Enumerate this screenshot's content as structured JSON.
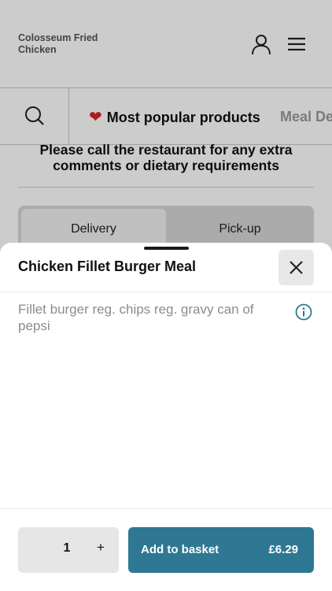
{
  "header": {
    "brand": "Colosseum Fried\nChicken"
  },
  "categories": {
    "active": "Most popular products",
    "next": "Meal De"
  },
  "notice": "Please call the restaurant for any extra comments or dietary requirements",
  "order_mode": {
    "delivery": "Delivery",
    "pickup": "Pick-up",
    "selected": "Delivery"
  },
  "sheet": {
    "title": "Chicken Fillet Burger Meal",
    "description": "Fillet burger reg. chips reg. gravy can of pepsi"
  },
  "footer": {
    "quantity": "1",
    "plus": "+",
    "add_label": "Add to basket",
    "price": "£6.29"
  },
  "colors": {
    "accent": "#2e7893",
    "heart": "#d8232a"
  },
  "icons": [
    "user-icon",
    "hamburger-menu-icon",
    "search-icon",
    "heart-icon",
    "close-icon",
    "info-icon",
    "plus-icon"
  ]
}
